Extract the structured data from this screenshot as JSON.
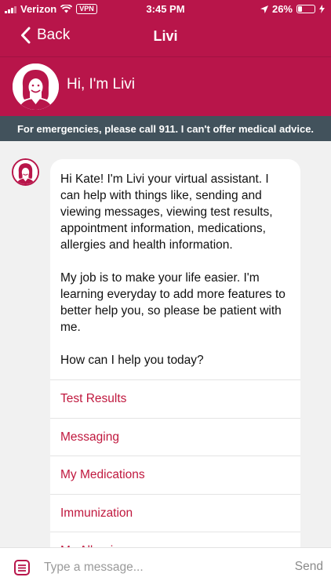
{
  "status_bar": {
    "carrier": "Verizon",
    "vpn_label": "VPN",
    "time": "3:45 PM",
    "battery_percent_label": "26%",
    "battery_level": 0.26
  },
  "nav": {
    "back_label": "Back",
    "title": "Livi"
  },
  "header": {
    "greeting": "Hi, I'm Livi"
  },
  "banner": {
    "text": "For emergencies, please call 911. I can't offer medical advice."
  },
  "chat": {
    "message_paragraphs": [
      "Hi Kate! I'm Livi your virtual assistant. I can help with things like, sending and viewing messages, viewing test results, appointment information, medications, allergies and health information.",
      "My job is to make your life easier. I'm learning everyday to add more features to better help you, so please be patient with me.",
      "How can I help you today?"
    ],
    "options": [
      "Test Results",
      "Messaging",
      "My Medications",
      "Immunization",
      "My Allergies"
    ]
  },
  "input": {
    "placeholder": "Type a message...",
    "value": "",
    "send_label": "Send"
  },
  "colors": {
    "brand": "#b8154a",
    "banner": "#42525c",
    "link": "#c0183e"
  },
  "icons": {
    "back": "chevron-left-icon",
    "menu": "menu-list-icon",
    "avatar": "livi-avatar-icon"
  }
}
